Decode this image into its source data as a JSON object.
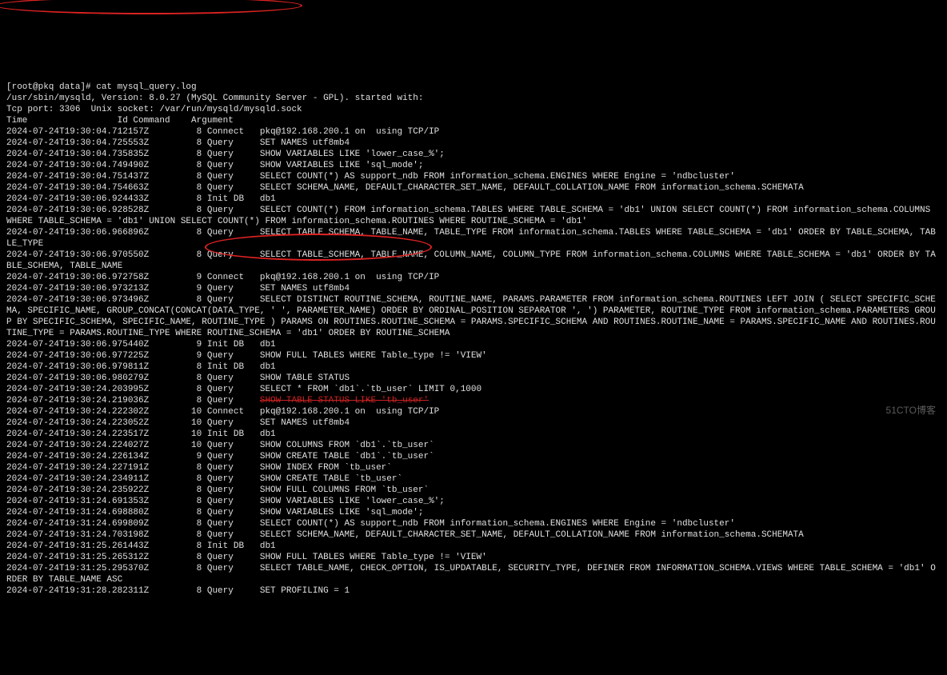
{
  "prompt": "[root@pkq data]# cat mysql_query.log",
  "header1": "/usr/sbin/mysqld, Version: 8.0.27 (MySQL Community Server - GPL). started with:",
  "header2": "Tcp port: 3306  Unix socket: /var/run/mysqld/mysqld.sock",
  "col_header": "Time                 Id Command    Argument",
  "hi_arg1": "SHOW TABLE STATUS",
  "hi_arg2": "SELECT * FROM `db1`.`tb_user` LIMIT 0,1000",
  "strike_arg": "SHOW TABLE STATUS LIKE 'tb_user'",
  "lines": [
    {
      "ts": "2024-07-24T19:30:04.712157Z",
      "id": "8",
      "cmd": "Connect",
      "arg": "pkq@192.168.200.1 on  using TCP/IP"
    },
    {
      "ts": "2024-07-24T19:30:04.725553Z",
      "id": "8",
      "cmd": "Query",
      "arg": "SET NAMES utf8mb4"
    },
    {
      "ts": "2024-07-24T19:30:04.735835Z",
      "id": "8",
      "cmd": "Query",
      "arg": "SHOW VARIABLES LIKE 'lower_case_%';"
    },
    {
      "ts": "2024-07-24T19:30:04.749490Z",
      "id": "8",
      "cmd": "Query",
      "arg": "SHOW VARIABLES LIKE 'sql_mode';"
    },
    {
      "ts": "2024-07-24T19:30:04.751437Z",
      "id": "8",
      "cmd": "Query",
      "arg": "SELECT COUNT(*) AS support_ndb FROM information_schema.ENGINES WHERE Engine = 'ndbcluster'"
    },
    {
      "ts": "2024-07-24T19:30:04.754663Z",
      "id": "8",
      "cmd": "Query",
      "arg": "SELECT SCHEMA_NAME, DEFAULT_CHARACTER_SET_NAME, DEFAULT_COLLATION_NAME FROM information_schema.SCHEMATA"
    },
    {
      "ts": "2024-07-24T19:30:06.924433Z",
      "id": "8",
      "cmd": "Init DB",
      "arg": "db1"
    },
    {
      "ts": "2024-07-24T19:30:06.928528Z",
      "id": "8",
      "cmd": "Query",
      "arg": "SELECT COUNT(*) FROM information_schema.TABLES WHERE TABLE_SCHEMA = 'db1' UNION SELECT COUNT(*) FROM information_schema.COLUMNS WHERE TABLE_SCHEMA = 'db1' UNION SELECT COUNT(*) FROM information_schema.ROUTINES WHERE ROUTINE_SCHEMA = 'db1'"
    },
    {
      "ts": "2024-07-24T19:30:06.966896Z",
      "id": "8",
      "cmd": "Query",
      "arg": "SELECT TABLE_SCHEMA, TABLE_NAME, TABLE_TYPE FROM information_schema.TABLES WHERE TABLE_SCHEMA = 'db1' ORDER BY TABLE_SCHEMA, TABLE_TYPE"
    },
    {
      "ts": "2024-07-24T19:30:06.970550Z",
      "id": "8",
      "cmd": "Query",
      "arg": "SELECT TABLE_SCHEMA, TABLE_NAME, COLUMN_NAME, COLUMN_TYPE FROM information_schema.COLUMNS WHERE TABLE_SCHEMA = 'db1' ORDER BY TABLE_SCHEMA, TABLE_NAME"
    },
    {
      "ts": "2024-07-24T19:30:06.972758Z",
      "id": "9",
      "cmd": "Connect",
      "arg": "pkq@192.168.200.1 on  using TCP/IP"
    },
    {
      "ts": "2024-07-24T19:30:06.973213Z",
      "id": "9",
      "cmd": "Query",
      "arg": "SET NAMES utf8mb4"
    },
    {
      "ts": "2024-07-24T19:30:06.973496Z",
      "id": "8",
      "cmd": "Query",
      "arg": "SELECT DISTINCT ROUTINE_SCHEMA, ROUTINE_NAME, PARAMS.PARAMETER FROM information_schema.ROUTINES LEFT JOIN ( SELECT SPECIFIC_SCHEMA, SPECIFIC_NAME, GROUP_CONCAT(CONCAT(DATA_TYPE, ' ', PARAMETER_NAME) ORDER BY ORDINAL_POSITION SEPARATOR ', ') PARAMETER, ROUTINE_TYPE FROM information_schema.PARAMETERS GROUP BY SPECIFIC_SCHEMA, SPECIFIC_NAME, ROUTINE_TYPE ) PARAMS ON ROUTINES.ROUTINE_SCHEMA = PARAMS.SPECIFIC_SCHEMA AND ROUTINES.ROUTINE_NAME = PARAMS.SPECIFIC_NAME AND ROUTINES.ROUTINE_TYPE = PARAMS.ROUTINE_TYPE WHERE ROUTINE_SCHEMA = 'db1' ORDER BY ROUTINE_SCHEMA"
    },
    {
      "ts": "2024-07-24T19:30:06.975440Z",
      "id": "9",
      "cmd": "Init DB",
      "arg": "db1"
    },
    {
      "ts": "2024-07-24T19:30:06.977225Z",
      "id": "9",
      "cmd": "Query",
      "arg": "SHOW FULL TABLES WHERE Table_type != 'VIEW'"
    },
    {
      "ts": "2024-07-24T19:30:06.979811Z",
      "id": "8",
      "cmd": "Init DB",
      "arg": "db1"
    },
    {
      "ts": "2024-07-24T19:30:06.980279Z",
      "id": "8",
      "cmd": "Query",
      "arg": "",
      "hi": "1"
    },
    {
      "ts": "2024-07-24T19:30:24.203995Z",
      "id": "8",
      "cmd": "Query",
      "arg": "",
      "hi": "2"
    },
    {
      "ts": "2024-07-24T19:30:24.219036Z",
      "id": "8",
      "cmd": "Query",
      "arg": "",
      "strike": true
    },
    {
      "ts": "2024-07-24T19:30:24.222302Z",
      "id": "10",
      "cmd": "Connect",
      "arg": "pkq@192.168.200.1 on  using TCP/IP"
    },
    {
      "ts": "2024-07-24T19:30:24.223052Z",
      "id": "10",
      "cmd": "Query",
      "arg": "SET NAMES utf8mb4"
    },
    {
      "ts": "2024-07-24T19:30:24.223517Z",
      "id": "10",
      "cmd": "Init DB",
      "arg": "db1"
    },
    {
      "ts": "2024-07-24T19:30:24.224027Z",
      "id": "10",
      "cmd": "Query",
      "arg": "SHOW COLUMNS FROM `db1`.`tb_user`"
    },
    {
      "ts": "2024-07-24T19:30:24.226134Z",
      "id": "9",
      "cmd": "Query",
      "arg": "SHOW CREATE TABLE `db1`.`tb_user`"
    },
    {
      "ts": "2024-07-24T19:30:24.227191Z",
      "id": "8",
      "cmd": "Query",
      "arg": "SHOW INDEX FROM `tb_user`"
    },
    {
      "ts": "2024-07-24T19:30:24.234911Z",
      "id": "8",
      "cmd": "Query",
      "arg": "SHOW CREATE TABLE `tb_user`"
    },
    {
      "ts": "2024-07-24T19:30:24.235922Z",
      "id": "8",
      "cmd": "Query",
      "arg": "SHOW FULL COLUMNS FROM `tb_user`"
    },
    {
      "ts": "2024-07-24T19:31:24.691353Z",
      "id": "8",
      "cmd": "Query",
      "arg": "SHOW VARIABLES LIKE 'lower_case_%';"
    },
    {
      "ts": "2024-07-24T19:31:24.698880Z",
      "id": "8",
      "cmd": "Query",
      "arg": "SHOW VARIABLES LIKE 'sql_mode';"
    },
    {
      "ts": "2024-07-24T19:31:24.699809Z",
      "id": "8",
      "cmd": "Query",
      "arg": "SELECT COUNT(*) AS support_ndb FROM information_schema.ENGINES WHERE Engine = 'ndbcluster'"
    },
    {
      "ts": "2024-07-24T19:31:24.703198Z",
      "id": "8",
      "cmd": "Query",
      "arg": "SELECT SCHEMA_NAME, DEFAULT_CHARACTER_SET_NAME, DEFAULT_COLLATION_NAME FROM information_schema.SCHEMATA"
    },
    {
      "ts": "2024-07-24T19:31:25.261443Z",
      "id": "8",
      "cmd": "Init DB",
      "arg": "db1"
    },
    {
      "ts": "2024-07-24T19:31:25.265312Z",
      "id": "8",
      "cmd": "Query",
      "arg": "SHOW FULL TABLES WHERE Table_type != 'VIEW'"
    },
    {
      "ts": "2024-07-24T19:31:25.295370Z",
      "id": "8",
      "cmd": "Query",
      "arg": "SELECT TABLE_NAME, CHECK_OPTION, IS_UPDATABLE, SECURITY_TYPE, DEFINER FROM INFORMATION_SCHEMA.VIEWS WHERE TABLE_SCHEMA = 'db1' ORDER BY TABLE_NAME ASC"
    },
    {
      "ts": "2024-07-24T19:31:28.282311Z",
      "id": "8",
      "cmd": "Query",
      "arg": "SET PROFILING = 1"
    }
  ],
  "watermark": "51CTO博客"
}
